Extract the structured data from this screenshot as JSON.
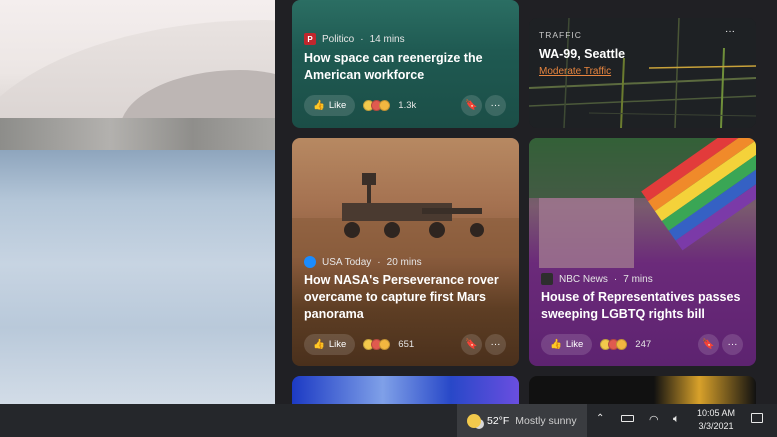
{
  "cards": {
    "politico": {
      "source": "Politico",
      "time": "14 mins",
      "logo_letter": "P",
      "headline": "How space can reenergize the American workforce",
      "like_label": "Like",
      "reactions": "1.3k"
    },
    "traffic": {
      "label": "TRAFFIC",
      "location": "WA-99, Seattle",
      "status": "Moderate Traffic",
      "more": "···"
    },
    "nasa": {
      "source": "USA Today",
      "time": "20 mins",
      "headline": "How NASA's Perseverance rover overcame to capture first Mars panorama",
      "like_label": "Like",
      "reactions": "651"
    },
    "nbc": {
      "source": "NBC News",
      "time": "7 mins",
      "headline": "House of Representatives passes sweeping LGBTQ rights bill",
      "like_label": "Like",
      "reactions": "247"
    }
  },
  "taskbar": {
    "temperature": "52°F",
    "condition": "Mostly sunny",
    "time": "10:05 AM",
    "date": "3/3/2021"
  },
  "colors": {
    "politico_bg": "#1f5a52",
    "nasa_bg": "#5e3e24",
    "nbc_bg": "#6b2a7a",
    "traffic_status": "#e8853f",
    "taskbar_bg": "#25272b"
  }
}
